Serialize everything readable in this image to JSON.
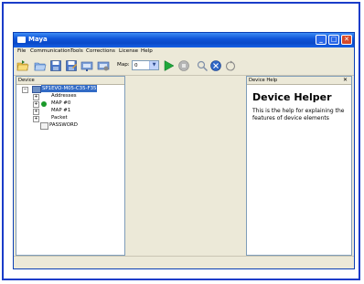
{
  "window": {
    "title": "Maya",
    "controls": {
      "minimize": "_",
      "maximize": "□",
      "close": "✕"
    }
  },
  "menu": {
    "items": [
      "File",
      "Communication",
      "Tools",
      "Corrections",
      "License",
      "Help"
    ]
  },
  "toolbar": {
    "map_label": "Map:",
    "map_value": "0",
    "icons": [
      "open-folder-icon",
      "open-file-icon",
      "save-icon",
      "save-as-icon",
      "device-icon",
      "device-settings-icon",
      "play-icon",
      "stop-icon",
      "search-icon",
      "close-circle-icon",
      "refresh-icon"
    ]
  },
  "device_panel": {
    "header": "Device",
    "root": "SP1EVO-M05-C35-F35",
    "items": [
      {
        "label": "Addresses",
        "expandable": true
      },
      {
        "label": "MAP #0",
        "expandable": true,
        "status": "green"
      },
      {
        "label": "MAP #1",
        "expandable": true
      },
      {
        "label": "Packet",
        "expandable": true
      },
      {
        "label": "PASSWORD",
        "expandable": false
      }
    ]
  },
  "help_panel": {
    "header": "Device Help",
    "close": "✕",
    "title": "Device Helper",
    "text": "This is the help for explaining the features of device elements"
  },
  "colors": {
    "titlebar": "#0a49c8",
    "selection": "#316ac5",
    "border": "#1a3cc9"
  }
}
